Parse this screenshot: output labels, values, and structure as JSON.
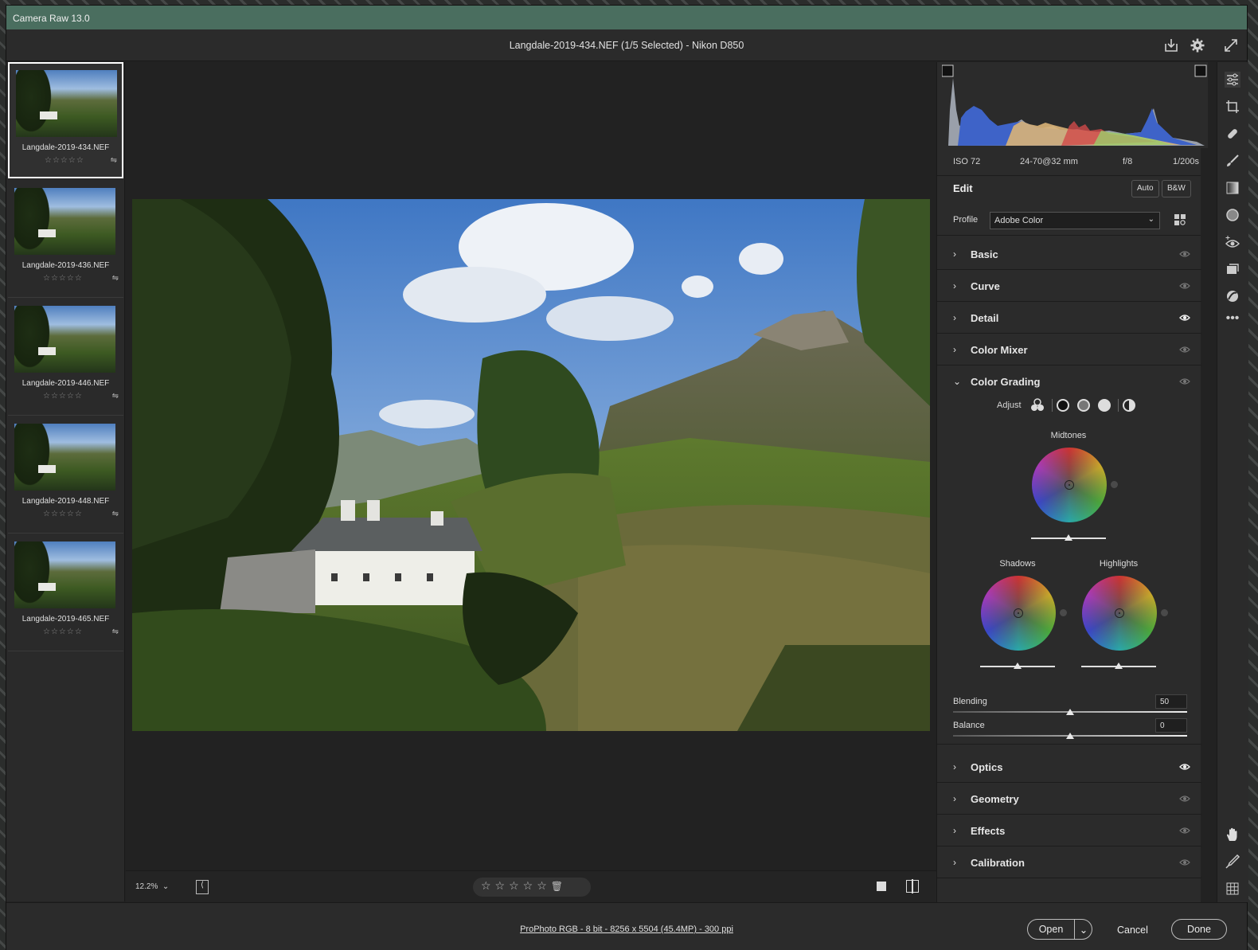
{
  "app": {
    "title": "Camera Raw 13.0"
  },
  "header": {
    "file_title": "Langdale-2019-434.NEF (1/5 Selected)  -  Nikon D850"
  },
  "filmstrip": {
    "items": [
      {
        "name": "Langdale-2019-434.NEF",
        "rating": "☆☆☆☆☆",
        "selected": true
      },
      {
        "name": "Langdale-2019-436.NEF",
        "rating": "☆☆☆☆☆",
        "selected": false
      },
      {
        "name": "Langdale-2019-446.NEF",
        "rating": "☆☆☆☆☆",
        "selected": false
      },
      {
        "name": "Langdale-2019-448.NEF",
        "rating": "☆☆☆☆☆",
        "selected": false
      },
      {
        "name": "Langdale-2019-465.NEF",
        "rating": "☆☆☆☆☆",
        "selected": false
      }
    ]
  },
  "statusbar": {
    "zoom": "12.2%",
    "rating": "☆☆☆☆☆"
  },
  "exif": {
    "iso": "ISO 72",
    "lens": "24-70@32 mm",
    "aperture": "f/8",
    "shutter": "1/200s"
  },
  "edit": {
    "title": "Edit",
    "auto_label": "Auto",
    "bw_label": "B&W",
    "profile_label": "Profile",
    "profile_value": "Adobe Color"
  },
  "sections": [
    {
      "title": "Basic",
      "expanded": false,
      "eye_active": false
    },
    {
      "title": "Curve",
      "expanded": false,
      "eye_active": false
    },
    {
      "title": "Detail",
      "expanded": false,
      "eye_active": true
    },
    {
      "title": "Color Mixer",
      "expanded": false,
      "eye_active": false
    },
    {
      "title": "Color Grading",
      "expanded": true,
      "eye_active": false
    },
    {
      "title": "Optics",
      "expanded": false,
      "eye_active": true
    },
    {
      "title": "Geometry",
      "expanded": false,
      "eye_active": false
    },
    {
      "title": "Effects",
      "expanded": false,
      "eye_active": false
    },
    {
      "title": "Calibration",
      "expanded": false,
      "eye_active": false
    }
  ],
  "color_grading": {
    "adjust_label": "Adjust",
    "midtones_label": "Midtones",
    "shadows_label": "Shadows",
    "highlights_label": "Highlights",
    "blending_label": "Blending",
    "blending_value": "50",
    "balance_label": "Balance",
    "balance_value": "0"
  },
  "footer": {
    "info": "ProPhoto RGB - 8 bit - 8256 x 5504 (45.4MP) - 300 ppi",
    "open_label": "Open",
    "cancel_label": "Cancel",
    "done_label": "Done"
  },
  "colors": {
    "titlebar": "#4a6e5f",
    "panel": "#2b2b2b",
    "canvas": "#222222"
  }
}
